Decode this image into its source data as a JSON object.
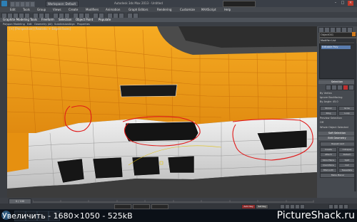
{
  "titlebar": {
    "workspace": "Workspace: Default",
    "title": "Autodesk 3ds Max 2013 - Untitled"
  },
  "menu": {
    "items": [
      "Edit",
      "Tools",
      "Group",
      "Views",
      "Create",
      "Modifiers",
      "Animation",
      "Graph Editors",
      "Rendering",
      "Customize",
      "MAXScript",
      "Help"
    ]
  },
  "ribbon": {
    "tabs": [
      "Graphite Modeling Tools",
      "Freeform",
      "Selection",
      "Object Paint",
      "Populate"
    ],
    "subtabs": [
      "Polygon Modeling",
      "Edit",
      "Geometry (All)",
      "Subdivision",
      "Align",
      "Properties"
    ]
  },
  "viewport": {
    "label": "[+] [Perspective] [Realistic + Edged Faces]"
  },
  "right_panel": {
    "object_name": "Object001",
    "modifier_list": "Modifier List",
    "stack_item": "Editable Poly",
    "rollouts": {
      "selection": "Selection",
      "soft_selection": "Soft Selection",
      "edit_geometry": "Edit Geometry"
    },
    "checks": [
      "By Vertex",
      "Ignore Backfacing",
      "By Angle: 45.0"
    ],
    "buttons": [
      "Shrink",
      "Grow",
      "Ring",
      "Loop",
      "Repeat Last",
      "Create",
      "Collapse",
      "Attach",
      "Detach",
      "Slice Plane",
      "Split",
      "QuickSlice",
      "Cut",
      "MSmooth",
      "Tessellate",
      "Make Planar"
    ],
    "preview_label": "Preview Selection",
    "off_label": "Off",
    "whole_label": "Whole Object Selected"
  },
  "timebar": {
    "slider": "0 / 100"
  },
  "status": {
    "key_label": "Auto Key",
    "set_key": "Set Key"
  },
  "watermark": {
    "left": "Увеличить - 1680×1050 - 525kB",
    "right": "PictureShack.ru"
  },
  "colors": {
    "car_orange": "#f2a019",
    "mesh_white": "#e8e8e8",
    "annotation_red": "#e01818",
    "panel_bg": "#464a50"
  }
}
